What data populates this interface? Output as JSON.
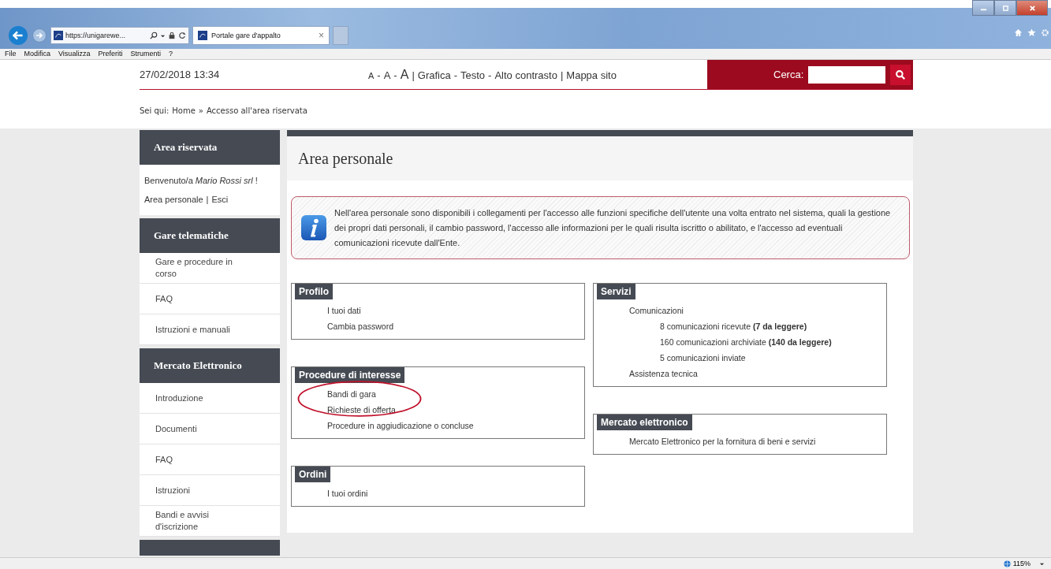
{
  "browser": {
    "address": "https://unigarewe...",
    "tab": {
      "title": "Portale gare d'appalto",
      "close": "×"
    },
    "menu": [
      "File",
      "Modifica",
      "Visualizza",
      "Preferiti",
      "Strumenti",
      "?"
    ],
    "zoom": "115%"
  },
  "header": {
    "datetime": "27/02/2018 13:34",
    "accessibility": [
      {
        "label": "A",
        "kind": "small"
      },
      {
        "label": "-",
        "kind": "sep"
      },
      {
        "label": "A",
        "kind": "medium"
      },
      {
        "label": "-",
        "kind": "sep"
      },
      {
        "label": "A",
        "kind": "large"
      },
      {
        "label": "|",
        "kind": "sep"
      },
      {
        "label": "Grafica",
        "kind": "link"
      },
      {
        "label": "-",
        "kind": "sep"
      },
      {
        "label": "Testo",
        "kind": "link"
      },
      {
        "label": "-",
        "kind": "sep"
      },
      {
        "label": "Alto contrasto",
        "kind": "link"
      },
      {
        "label": "|",
        "kind": "sep"
      },
      {
        "label": "Mappa sito",
        "kind": "link"
      }
    ],
    "search": {
      "label": "Cerca:"
    }
  },
  "breadcrumb": {
    "prefix": "Sei qui:",
    "separator": "»",
    "items": [
      "Home",
      "Accesso all'area riservata"
    ]
  },
  "sidebar": [
    {
      "title": "Area riservata",
      "kind": "welcome",
      "welcome": "Benvenuto/a *Mario Rossi srl* !",
      "links": [
        "Area personale",
        "Esci"
      ],
      "separator": "|"
    },
    {
      "title": "Gare telematiche",
      "kind": "menu",
      "items": [
        "Gare e procedure in corso",
        "FAQ",
        "Istruzioni e manuali"
      ]
    },
    {
      "title": "Mercato Elettronico",
      "kind": "menu",
      "items": [
        "Introduzione",
        "Documenti",
        "FAQ",
        "Istruzioni",
        "Bandi e avvisi d'iscrizione"
      ]
    }
  ],
  "main": {
    "title": "Area personale",
    "info": "Nell'area personale sono disponibili i collegamenti per l'accesso alle funzioni specifiche dell'utente una volta entrato nel sistema, quali la gestione dei propri dati personali, il cambio password, l'accesso alle informazioni per le quali risulta iscritto o abilitato, e l'accesso ad eventuali comunicazioni ricevute dall'Ente.",
    "left": [
      {
        "title": "Profilo",
        "items": [
          {
            "label": "I tuoi dati"
          },
          {
            "label": "Cambia password"
          }
        ]
      },
      {
        "title": "Procedure di interesse",
        "items": [
          {
            "label": "Bandi di gara"
          },
          {
            "label": "Richieste di offerta"
          },
          {
            "label": "Procedure in aggiudicazione o concluse"
          }
        ]
      },
      {
        "title": "Ordini",
        "items": [
          {
            "label": "I tuoi ordini"
          }
        ]
      }
    ],
    "right": [
      {
        "title": "Servizi",
        "items": [
          {
            "label": "Comunicazioni",
            "children": [
              {
                "label": "8 comunicazioni ricevute **(7 da leggere)**"
              },
              {
                "label": "160 comunicazioni archiviate  **(140 da leggere)**"
              },
              {
                "label": "5 comunicazioni inviate"
              }
            ]
          },
          {
            "label": "Assistenza tecnica"
          }
        ]
      },
      {
        "title": "Mercato elettronico",
        "items": [
          {
            "label": "Mercato Elettronico per la fornitura di beni e servizi"
          }
        ]
      }
    ]
  }
}
